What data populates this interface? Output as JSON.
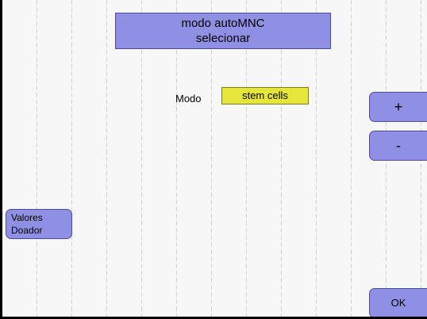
{
  "title": {
    "line1": "modo autoMNC",
    "line2": "selecionar"
  },
  "mode": {
    "label": "Modo",
    "value": "stem cells"
  },
  "buttons": {
    "plus": "+",
    "minus": "-",
    "donor_line1": "Valores",
    "donor_line2": "Doador",
    "ok": "OK"
  },
  "colors": {
    "button": "#8f8fe4",
    "value_field": "#e5e53a",
    "background": "#f7f7f7"
  }
}
